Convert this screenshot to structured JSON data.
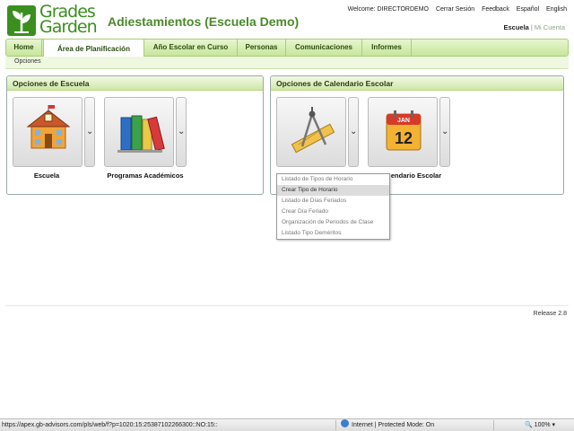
{
  "header": {
    "logo_text_1": "Grades",
    "logo_text_2": "Garden",
    "title": "Adiestamientos (Escuela Demo)",
    "welcome": "Welcome: DIRECTORDEMO",
    "links": [
      "Cerrar Sesión",
      "Feedback",
      "Español",
      "English"
    ],
    "context_active": "Escuela",
    "context_other": "Mi Cuenta"
  },
  "nav": {
    "tabs": [
      "Home",
      "Área de Planificación",
      "Año Escolar en Curso",
      "Personas",
      "Comunicaciones",
      "Informes"
    ],
    "active_tab": "Área de Planificación",
    "sub_item": "Opciones"
  },
  "panels": {
    "school": {
      "title": "Opciones de Escuela",
      "tiles": [
        {
          "label": "Escuela",
          "icon": "school-building-icon"
        },
        {
          "label": "Programas Académicos",
          "icon": "books-icon"
        }
      ]
    },
    "calendar": {
      "title": "Opciones de Calendario Escolar",
      "tiles": [
        {
          "label": "",
          "icon": "drafting-tools-icon"
        },
        {
          "label": "endario Escolar",
          "icon": "calendar-icon"
        }
      ],
      "calendar_month": "JAN",
      "calendar_day": "12"
    }
  },
  "dropdown": {
    "items": [
      "Listado de Tipos de Horario",
      "Crear Tipo de Horario",
      "Listado de Días Feriados",
      "Crear Día Feriado",
      "Organización de Periodos de Clase",
      "Listado Tipo Deméritos"
    ],
    "highlighted": "Crear Tipo de Horario"
  },
  "footer": {
    "release": "Release 2.8"
  },
  "statusbar": {
    "url": "https://apex.gb-advisors.com/pls/web/f?p=1020:15:25387102266300::NO:15::",
    "zone": "Internet | Protected Mode: On",
    "zoom": "100%"
  },
  "colors": {
    "brand_green": "#3a8f1e",
    "title_green": "#4a8a2a",
    "nav_bg": "#c7e69a"
  }
}
